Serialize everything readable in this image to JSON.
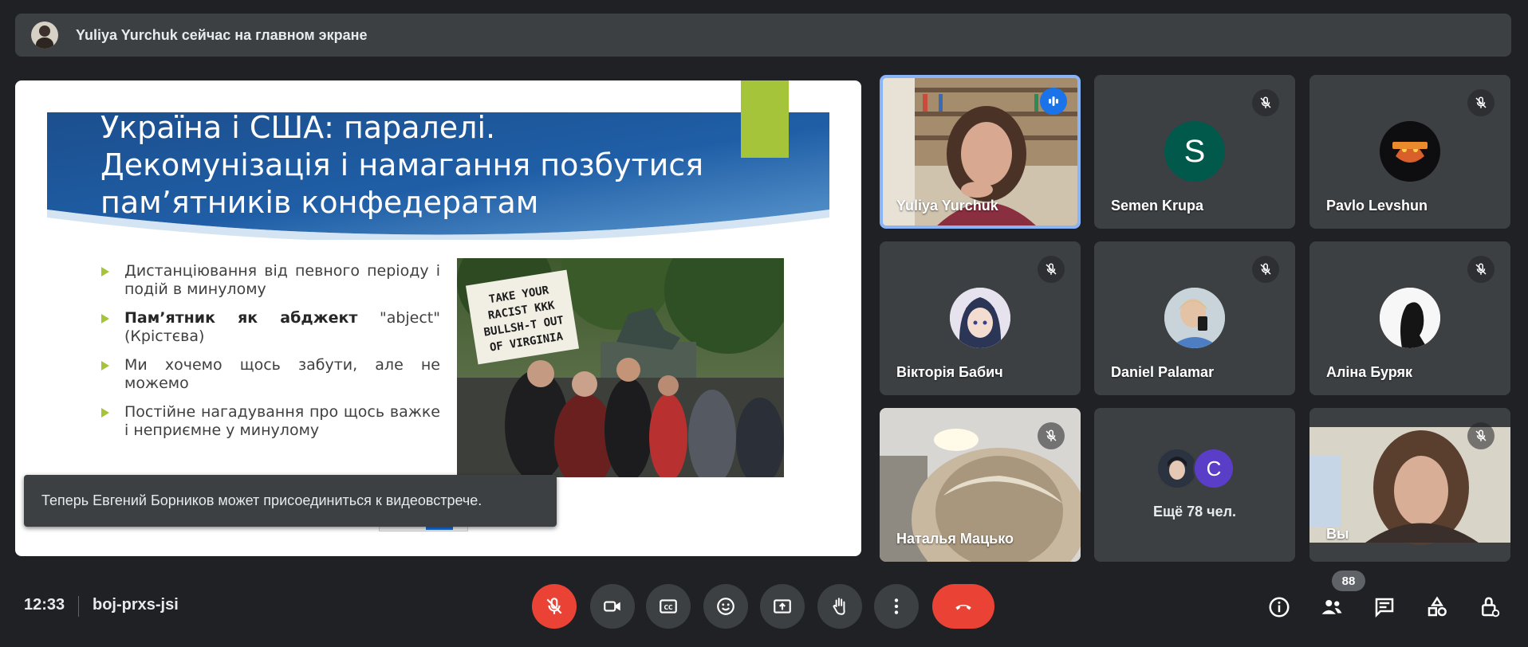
{
  "banner": {
    "text": "Yuliya Yurchuk сейчас на главном экране",
    "avatar_icon": "user-avatar"
  },
  "slide": {
    "title_lines": [
      "Україна і США: паралелі.",
      "Декомунізація і намагання позбутися",
      "пам’ятників конфедератам"
    ],
    "bullets": [
      {
        "bold": "",
        "text": "Дистанціювання від певного періоду і подій в минулому"
      },
      {
        "bold": "Пам’ятник як абджект",
        "text": " \"abject\" (Крістєва)"
      },
      {
        "bold": "",
        "text": "Ми хочемо щось забути, але не можемо"
      },
      {
        "bold": "",
        "text": "Постійне нагадування про щось важке і неприємне у минулому"
      }
    ],
    "sign_lines": [
      "TAKE YOUR",
      "RACIST KKK",
      "BULLSH-T OUT",
      "OF VIRGINIA"
    ],
    "accent_color": "#a5c43a",
    "band_color": "#1e4f97"
  },
  "toast": {
    "text": "Теперь Евгений Борников может присоединиться к видеовстрече."
  },
  "tiles": [
    {
      "name": "Yuliya Yurchuk",
      "state": "speaking"
    },
    {
      "name": "Semen Krupa",
      "letter": "S",
      "state": "muted"
    },
    {
      "name": "Pavlo Levshun",
      "state": "muted"
    },
    {
      "name": "Вікторія Бабич",
      "state": "muted"
    },
    {
      "name": "Daniel Palamar",
      "state": "muted"
    },
    {
      "name": "Аліна Буряк",
      "state": "muted"
    },
    {
      "name": "Наталья Мацько",
      "state": "muted"
    },
    {
      "name": "Ещё 78 чел.",
      "letter": "C"
    },
    {
      "name": "Вы",
      "state": "muted"
    }
  ],
  "footer": {
    "time": "12:33",
    "meeting_code": "boj-prxs-jsi",
    "participants_count": "88",
    "controls": [
      "mic-off-icon",
      "camera-icon",
      "captions-icon",
      "emoji-icon",
      "present-icon",
      "raise-hand-icon",
      "more-icon",
      "end-call-icon"
    ],
    "side_controls": [
      "info-icon",
      "people-icon",
      "chat-icon",
      "activities-icon",
      "host-controls-icon"
    ]
  },
  "colors": {
    "background": "#202124",
    "surface": "#3c4043",
    "danger": "#ea4335",
    "active_border": "#8ab4f8",
    "speaking": "#1a73e8"
  }
}
